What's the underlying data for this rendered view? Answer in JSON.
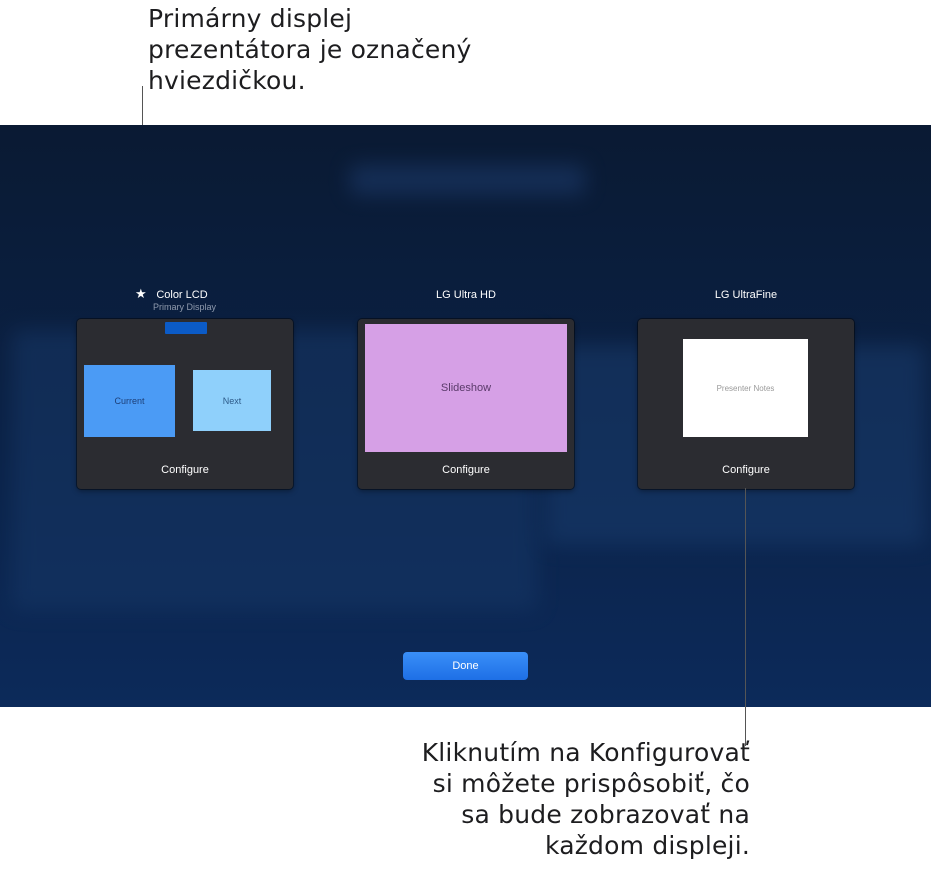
{
  "callouts": {
    "top": "Primárny displej\nprezentátora je označený\nhviezdičkou.",
    "bottom": "Kliknutím na Konfigurovať\nsi môžete prispôsobiť, čo\nsa bude zobrazovať na\nkaždom displeji."
  },
  "displays": [
    {
      "name": "Color LCD",
      "subtitle": "Primary Display",
      "primary": true,
      "thumb": {
        "current_label": "Current",
        "next_label": "Next"
      },
      "configure_label": "Configure"
    },
    {
      "name": "LG Ultra HD",
      "thumb": {
        "label": "Slideshow"
      },
      "configure_label": "Configure"
    },
    {
      "name": "LG UltraFine",
      "thumb": {
        "label": "Presenter Notes"
      },
      "configure_label": "Configure"
    }
  ],
  "done_label": "Done",
  "icons": {
    "primary_marker": "star-icon"
  },
  "colors": {
    "background": "#0b2247",
    "card": "#2b2c31",
    "current": "#4b9bf5",
    "next": "#8fd0fb",
    "slideshow": "#d6a0e6",
    "done_button": "#1e6fe6"
  }
}
